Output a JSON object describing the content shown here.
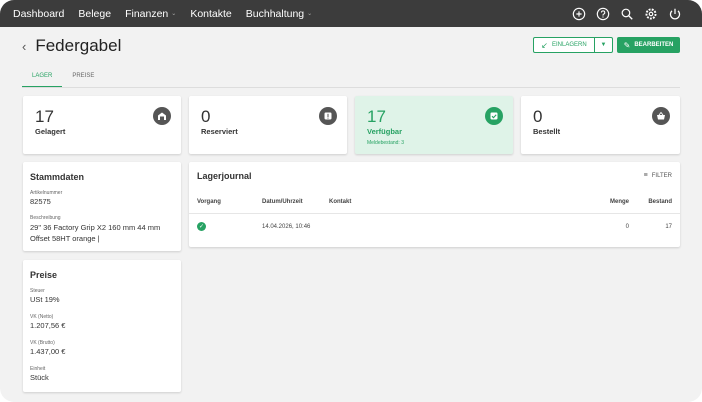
{
  "nav": {
    "items": [
      {
        "label": "Dashboard",
        "dropdown": false
      },
      {
        "label": "Belege",
        "dropdown": false
      },
      {
        "label": "Finanzen",
        "dropdown": true
      },
      {
        "label": "Kontakte",
        "dropdown": false
      },
      {
        "label": "Buchhaltung",
        "dropdown": true
      }
    ],
    "icons": [
      "plus-circle-icon",
      "help-icon",
      "search-icon",
      "settings-icon",
      "power-icon"
    ]
  },
  "header": {
    "back_icon": "chevron-left-icon",
    "title": "Federgabel",
    "einlagern_label": "EINLAGERN",
    "bearbeiten_label": "BEARBEITEN"
  },
  "tabs": [
    {
      "label": "LAGER",
      "active": true
    },
    {
      "label": "PREISE",
      "active": false
    }
  ],
  "stats": [
    {
      "value": "17",
      "label": "Gelagert",
      "sub": "",
      "icon": "warehouse-icon",
      "highlight": false
    },
    {
      "value": "0",
      "label": "Reserviert",
      "sub": "",
      "icon": "alert-icon",
      "highlight": false
    },
    {
      "value": "17",
      "label": "Verfügbar",
      "sub": "Meldebestand: 3",
      "icon": "check-box-icon",
      "highlight": true
    },
    {
      "value": "0",
      "label": "Bestellt",
      "sub": "",
      "icon": "basket-icon",
      "highlight": false
    }
  ],
  "stammdaten": {
    "title": "Stammdaten",
    "artikelnummer_label": "Artikelnummer",
    "artikelnummer": "82575",
    "beschreibung_label": "Beschreibung",
    "beschreibung_line1": "29\" 36 Factory Grip X2 160 mm 44 mm",
    "beschreibung_line2": "Offset 58HT orange |"
  },
  "preise": {
    "title": "Preise",
    "steuer_label": "Steuer",
    "steuer": "USt 19%",
    "vk_netto_label": "VK (Netto)",
    "vk_netto": "1.207,56 €",
    "vk_brutto_label": "VK (Brutto)",
    "vk_brutto": "1.437,00 €",
    "einheit_label": "Einheit",
    "einheit": "Stück"
  },
  "journal": {
    "title": "Lagerjournal",
    "filter_label": "FILTER",
    "columns": [
      "Vorgang",
      "Datum/Uhrzeit",
      "Kontakt",
      "Menge",
      "Bestand"
    ],
    "rows": [
      {
        "vorgang_icon": "check-circle-icon",
        "datum": "14.04.2026, 10:46",
        "kontakt": "",
        "menge": "0",
        "bestand": "17"
      }
    ]
  },
  "colors": {
    "accent": "#27a263",
    "topbar": "#3c3c3c",
    "highlight_bg": "#dff3e8"
  }
}
